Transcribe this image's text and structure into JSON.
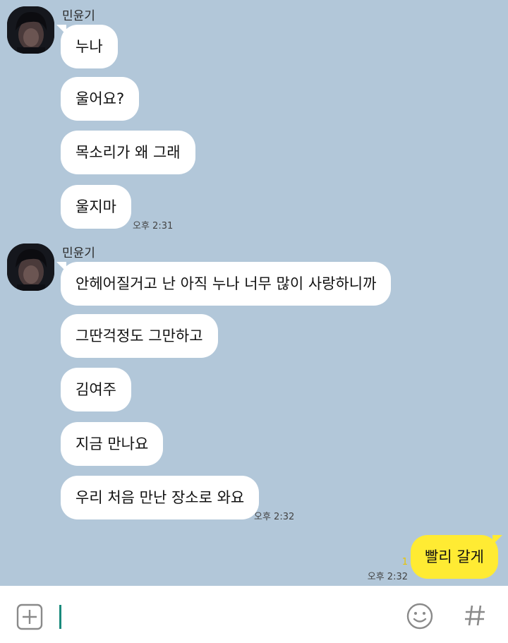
{
  "groups": [
    {
      "sender": "민윤기",
      "messages": [
        "누나",
        "울어요?",
        "목소리가 왜 그래",
        "울지마"
      ],
      "time": "오후 2:31"
    },
    {
      "sender": "민윤기",
      "messages": [
        "안헤어질거고 난 아직 누나 너무 많이 사랑하니까",
        "그딴걱정도 그만하고",
        "김여주",
        "지금 만나요",
        "우리 처음 만난 장소로 와요"
      ],
      "time": "오후 2:32"
    }
  ],
  "my_message": {
    "text": "빨리 갈게",
    "unread_count": "1",
    "time": "오후 2:32"
  },
  "input_bar": {
    "value": "",
    "icons": [
      "plus-icon",
      "emoticon-icon",
      "hashtag-icon"
    ]
  },
  "colors": {
    "chat_background": "#b2c7d9",
    "other_bubble": "#ffffff",
    "my_bubble": "#ffeb33",
    "unread_count": "#e9c400",
    "cursor": "#1a8a7c"
  }
}
